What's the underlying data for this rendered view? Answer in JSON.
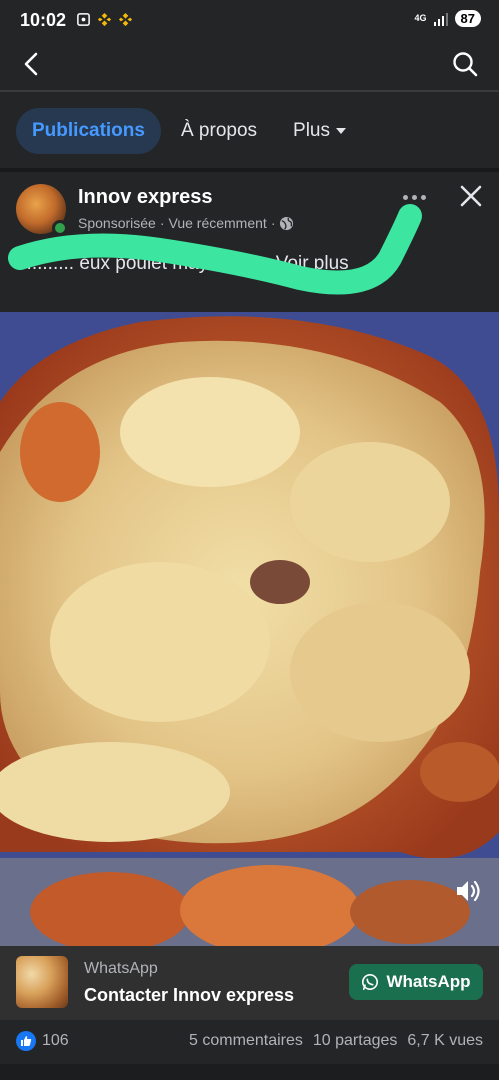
{
  "status_bar": {
    "time": "10:02",
    "network": "4G",
    "battery": "87"
  },
  "topnav": {
    "back_icon": "chevron-left-icon",
    "search_icon": "search-icon"
  },
  "tabs": [
    {
      "label": "Publications",
      "active": true
    },
    {
      "label": "À propos",
      "active": false
    },
    {
      "label": "Plus",
      "active": false
    }
  ],
  "post": {
    "page_name": "Innov express",
    "meta_sponsored": "Sponsorisée",
    "meta_dot": "·",
    "meta_recent": "Vue récemment",
    "meta_dot2": "·",
    "text": "........... eux poulet mayo est ... Voir plus",
    "more_icon": "more-horizontal-icon",
    "close_icon": "close-icon"
  },
  "media": {
    "volume_icon": "volume-icon"
  },
  "cta": {
    "label": "WhatsApp",
    "title": "Contacter Innov express",
    "button_label": "WhatsApp"
  },
  "engagement": {
    "likes": "106",
    "comments": "5 commentaires",
    "shares": "10 partages",
    "views": "6,7 K vues"
  },
  "colors": {
    "background": "#242526",
    "accent_blue": "#4599ff",
    "whatsapp_green": "#1a6f4e",
    "scribble": "#3ce6a0"
  }
}
